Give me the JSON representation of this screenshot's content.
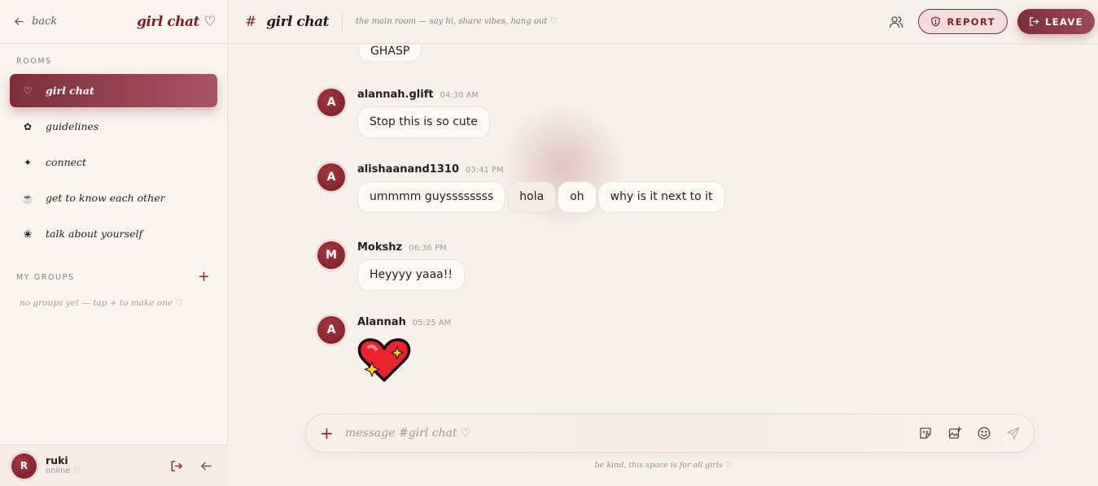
{
  "sidebar": {
    "back_label": "back",
    "brand": "girl chat ♡",
    "rooms_label": "ROOMS",
    "rooms": [
      {
        "icon": "♡",
        "label": "girl chat",
        "active": true
      },
      {
        "icon": "✿",
        "label": "guidelines"
      },
      {
        "icon": "✦",
        "label": "connect"
      },
      {
        "icon": "☕",
        "label": "get to know each other"
      },
      {
        "icon": "❀",
        "label": "talk about yourself"
      }
    ],
    "groups_label": "MY GROUPS",
    "groups_add": "+",
    "no_groups": "no groups yet — tap + to make one ♡",
    "user": {
      "initial": "R",
      "name": "ruki",
      "status": "online ♡"
    }
  },
  "header": {
    "hash": "#",
    "title": "girl chat",
    "description": "the main room — say hi, share vibes, hang out ♡",
    "report_label": "REPORT",
    "leave_label": "LEAVE"
  },
  "messages": {
    "partial_bubble": "GHASP",
    "items": [
      {
        "initial": "A",
        "author": "alannah.glift",
        "time": "04:30 AM",
        "bubbles": [
          "Stop this is so cute"
        ]
      },
      {
        "initial": "A",
        "author": "alishaanand1310",
        "time": "03:41 PM",
        "bubbles": [
          "ummmm guyssssssss",
          "hola",
          "oh",
          "why is it next to it"
        ]
      },
      {
        "initial": "M",
        "author": "Mokshz",
        "time": "06:36 PM",
        "bubbles": [
          "Heyyyy yaaa!!"
        ]
      },
      {
        "initial": "A",
        "author": "Alannah",
        "time": "05:25 AM",
        "emoji": "sparkling-heart"
      }
    ]
  },
  "composer": {
    "plus": "+",
    "placeholder": "message #girl chat ♡"
  },
  "footer_note": "be kind, this space is for all girls ♡",
  "colors": {
    "accent": "#7a1f2b",
    "accent_light": "#a85565",
    "background": "#f7f1eb",
    "sidebar_bg": "#faf5ef"
  }
}
